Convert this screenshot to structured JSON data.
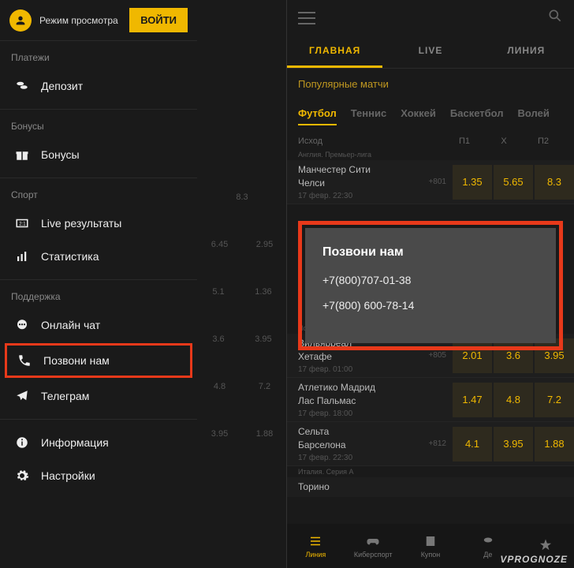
{
  "left": {
    "mode": "Режим просмотра",
    "login": "ВОЙТИ",
    "sections": {
      "payments": "Платежи",
      "bonuses": "Бонусы",
      "sport": "Спорт",
      "support": "Поддержка"
    },
    "items": {
      "deposit": "Депозит",
      "bonuses": "Бонусы",
      "live": "Live результаты",
      "stats": "Статистика",
      "chat": "Онлайн чат",
      "call": "Позвони нам",
      "telegram": "Телеграм",
      "info": "Информация",
      "settings": "Настройки"
    },
    "ghost": {
      "r1a": "8.3",
      "r2a": "6.45",
      "r2b": "2.95",
      "r3a": "5.1",
      "r3b": "1.36",
      "r4a": "3.6",
      "r4b": "3.95",
      "r5a": "4.8",
      "r5b": "7.2",
      "r6a": "3.95",
      "r6b": "1.88"
    }
  },
  "right": {
    "tabs": {
      "main": "ГЛАВНАЯ",
      "live": "LIVE",
      "line": "ЛИНИЯ"
    },
    "popLabel": "Популярные матчи",
    "sports": {
      "football": "Футбол",
      "tennis": "Теннис",
      "hockey": "Хоккей",
      "basketball": "Баскетбол",
      "volleyball": "Волей"
    },
    "hdr": {
      "outcome": "Исход",
      "p1": "П1",
      "x": "X",
      "p2": "П2"
    },
    "leagues": {
      "epl": "Англия. Премьер-лига",
      "laliga": "Испания. Ла Лига",
      "seriea": "Италия. Серия А"
    },
    "matches": {
      "m1": {
        "t1": "Манчестер Сити",
        "t2": "Челси",
        "meta": "17 февр. 22:30",
        "live": "+801",
        "o1": "1.35",
        "ox": "5.65",
        "o2": "8.3"
      },
      "m2": {
        "t1": "Вильярреал",
        "t2": "Хетафе",
        "meta": "17 февр. 01:00",
        "live": "+805",
        "o1": "2.01",
        "ox": "3.6",
        "o2": "3.95"
      },
      "m3": {
        "t1": "Атлетико Мадрид",
        "t2": "Лас Пальмас",
        "meta": "17 февр. 18:00",
        "live": "",
        "o1": "1.47",
        "ox": "4.8",
        "o2": "7.2"
      },
      "m4": {
        "t1": "Сельта",
        "t2": "Барселона",
        "meta": "17 февр. 22:30",
        "live": "+812",
        "o1": "4.1",
        "ox": "3.95",
        "o2": "1.88"
      },
      "m5": {
        "t1": "Торино",
        "t2": "",
        "meta": "",
        "live": "",
        "o1": "",
        "ox": "",
        "o2": ""
      }
    },
    "modal": {
      "title": "Позвони нам",
      "phone1": "+7(800)707-01-38",
      "phone2": "+7(800) 600-78-14"
    },
    "bottomNav": {
      "line": "Линия",
      "cyber": "Киберспорт",
      "coupon": "Купон",
      "dep": "Де",
      "fav": ""
    }
  },
  "watermark": "VPROGNOZE"
}
